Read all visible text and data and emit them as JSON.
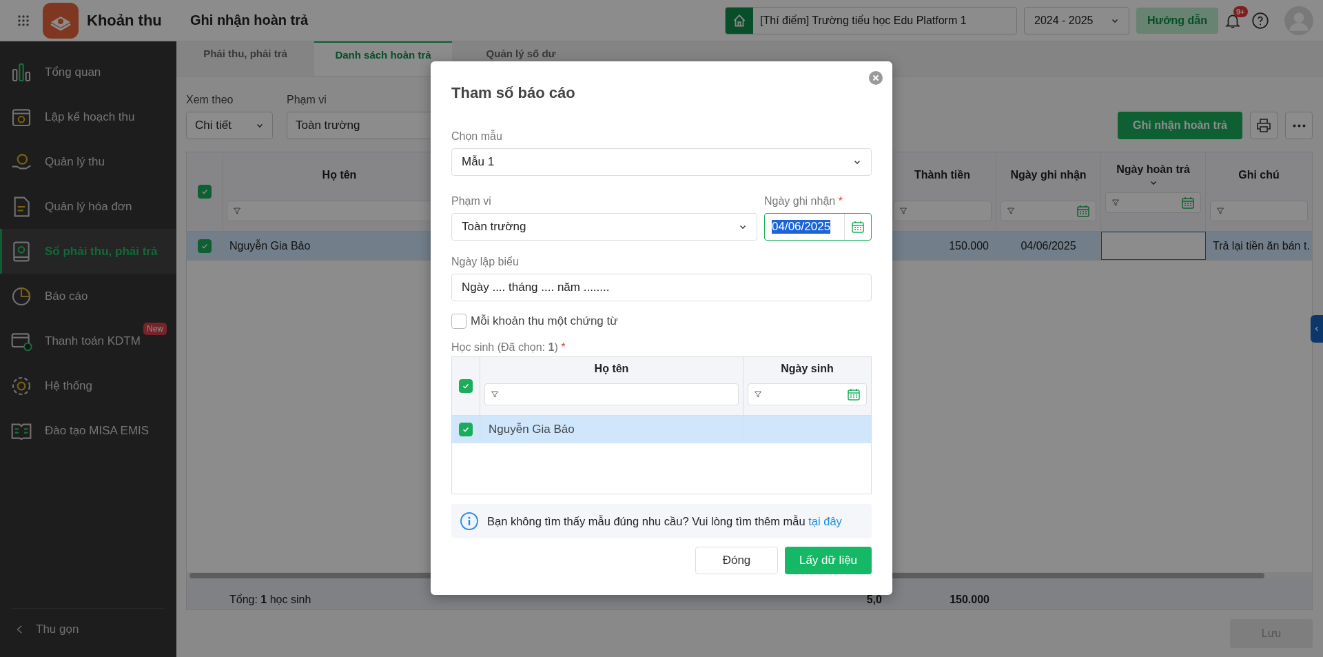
{
  "app": {
    "name": "Khoản thu",
    "page_title": "Ghi nhận hoàn trả"
  },
  "header": {
    "school": "[Thí điểm] Trường tiểu học Edu Platform 1",
    "year": "2024 - 2025",
    "guide_button": "Hướng dẫn",
    "notification_badge": "9+"
  },
  "sidebar": {
    "items": [
      {
        "label": "Tổng quan",
        "selected": false
      },
      {
        "label": "Lập kế hoạch thu",
        "selected": false
      },
      {
        "label": "Quản lý thu",
        "selected": false
      },
      {
        "label": "Quản lý hóa đơn",
        "selected": false
      },
      {
        "label": "Sổ phải thu, phải trả",
        "selected": true
      },
      {
        "label": "Báo cáo",
        "selected": false
      },
      {
        "label": "Thanh toán KDTM",
        "selected": false,
        "badge": "New"
      },
      {
        "label": "Hệ thống",
        "selected": false
      },
      {
        "label": "Đào tạo MISA EMIS",
        "selected": false
      }
    ],
    "collapse": "Thu gọn"
  },
  "tabs": [
    {
      "label": "Phải thu, phải trả",
      "selected": false
    },
    {
      "label": "Danh sách hoàn trả",
      "selected": true
    },
    {
      "label": "Quản lý số dư",
      "selected": false
    }
  ],
  "filters": [
    {
      "label": "Xem theo",
      "value": "Chi tiết"
    },
    {
      "label": "Phạm vi",
      "value": "Toàn trường"
    }
  ],
  "actions": {
    "primary": "Ghi nhận hoàn trả"
  },
  "table": {
    "all_selected": true,
    "columns": {
      "name": "Họ tên",
      "amount": "Thành tiền",
      "recorded_date": "Ngày ghi nhận",
      "return_date": "Ngày hoàn trả",
      "note": "Ghi chú"
    },
    "rows": [
      {
        "selected": true,
        "name": "Nguyễn Gia Bảo",
        "amount": "150.000",
        "recorded_date": "04/06/2025",
        "return_date_focused": true,
        "note": "Trả lại tiền ăn bán t."
      }
    ],
    "footer": {
      "total": "Tổng: **1** học sinh",
      "column_3": "5,0",
      "amount": "150.000"
    }
  },
  "save_button": {
    "label": "Lưu",
    "disabled": true
  },
  "report_dialog": {
    "title": "Tham số báo cáo",
    "template": {
      "label": "Chọn mẫu",
      "value": "Mẫu 1"
    },
    "scope": {
      "label": "Phạm vi",
      "value": "Toàn trường"
    },
    "record_date": {
      "label": "Ngày ghi nhận",
      "required_mark": "*",
      "value": "04/06/2025",
      "text_selected": true
    },
    "report_date": {
      "label": "Ngày lập biểu",
      "value": "Ngày .... tháng .... năm ........"
    },
    "separate_voucher": {
      "label": "Mỗi khoản thu một chứng từ",
      "checked": false
    },
    "students": {
      "label": "Học sinh (Đã chọn: **1**)",
      "required_mark": "*",
      "all_selected": true,
      "columns": [
        "Họ tên",
        "Ngày sinh"
      ],
      "rows": [
        {
          "selected": true,
          "name": "Nguyễn Gia Bảo"
        }
      ]
    },
    "info": {
      "text": "Bạn không tìm thấy mẫu đúng nhu cầu? Vui lòng tìm thêm mẫu",
      "link": "tại đây"
    },
    "buttons": [
      {
        "label": "Đóng",
        "kind": "secondary"
      },
      {
        "label": "Lấy dữ liệu",
        "kind": "primary"
      }
    ]
  }
}
